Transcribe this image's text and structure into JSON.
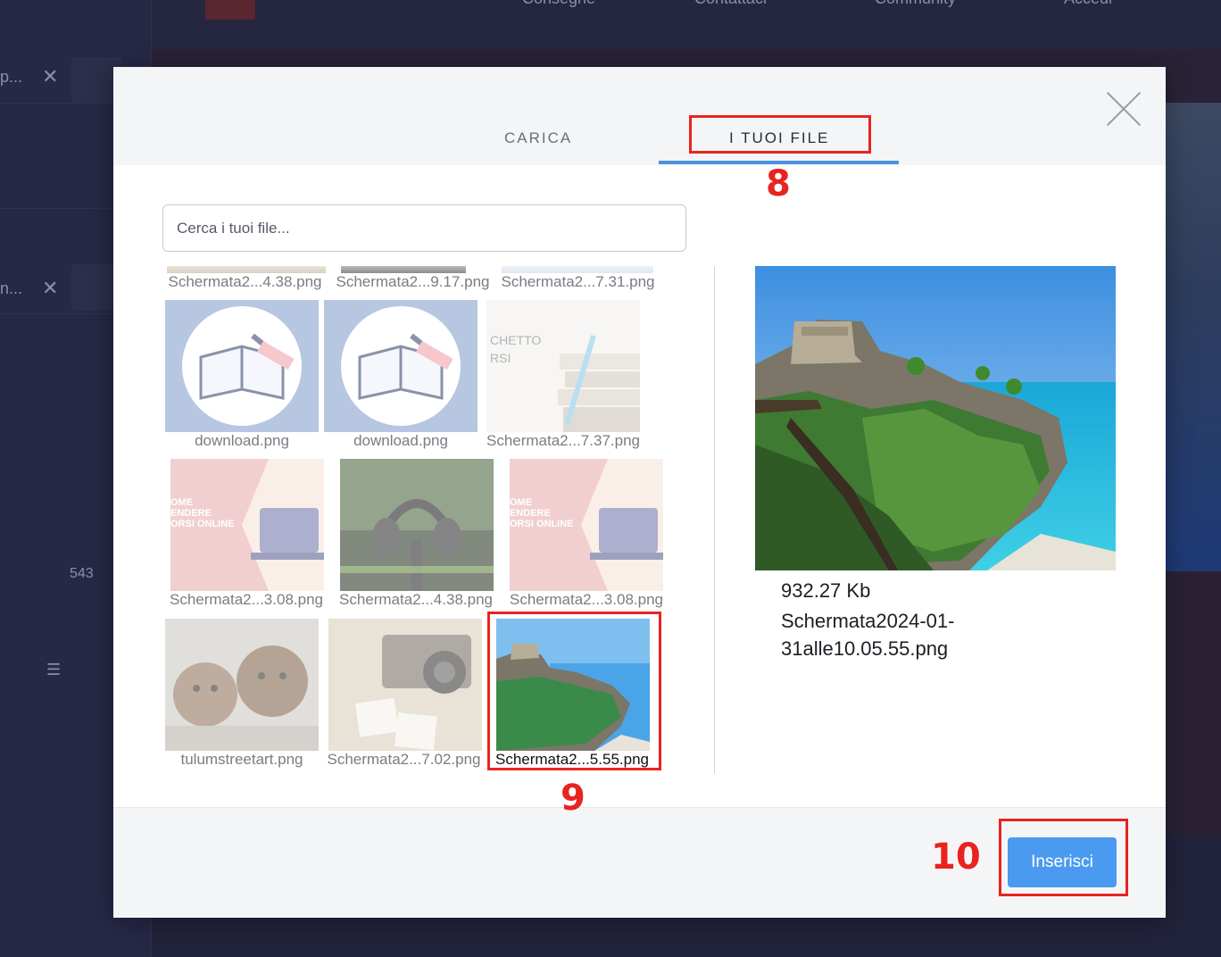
{
  "background": {
    "nav_items": [
      "Consegne",
      "Contattaci",
      "Community",
      "Accedi"
    ],
    "rows": [
      {
        "text": "p...",
        "close": "✕"
      },
      {
        "text": "n...",
        "close": "✕"
      }
    ],
    "count": "543"
  },
  "modal": {
    "tabs": [
      {
        "label": "CARICA",
        "active": false
      },
      {
        "label": "I TUOI FILE",
        "active": true
      }
    ],
    "search_placeholder": "Cerca i tuoi file...",
    "files": [
      {
        "label": "Schermata2...4.38.png",
        "partial": true,
        "colors": [
          "#e9e3d8",
          "#d8cfc3"
        ]
      },
      {
        "label": "Schermata2...9.17.png",
        "partial": true,
        "colors": [
          "#b9b9b9",
          "#8d8d8d"
        ]
      },
      {
        "label": "Schermata2...7.31.png",
        "partial": true,
        "colors": [
          "#eef3f7",
          "#dfe8ef"
        ]
      },
      {
        "label": "download.png",
        "icon": "book-writing-icon",
        "colors": [
          "#7d99c9",
          "#ffffff"
        ]
      },
      {
        "label": "download.png",
        "icon": "book-writing-icon",
        "colors": [
          "#7d99c9",
          "#ffffff"
        ]
      },
      {
        "label": "Schermata2...7.37.png",
        "icon": "books-stack-image",
        "colors": [
          "#f1efec",
          "#dcd5cb"
        ]
      },
      {
        "label": "Schermata2...3.08.png",
        "icon": "course-banner-image",
        "colors": [
          "#e6a9ad",
          "#f7e2d7"
        ]
      },
      {
        "label": "Schermata2...4.38.png",
        "icon": "headphones-image",
        "colors": [
          "#3f5a2f",
          "#1d2a18"
        ]
      },
      {
        "label": "Schermata2...3.08.png",
        "icon": "course-banner-image",
        "colors": [
          "#e6a9ad",
          "#f7e2d7"
        ]
      },
      {
        "label": "tulumstreetart.png",
        "icon": "street-art-image",
        "colors": [
          "#c9c6bf",
          "#7a6a58"
        ]
      },
      {
        "label": "Schermata2...7.02.png",
        "icon": "camera-photos-image",
        "colors": [
          "#d7cbb8",
          "#6f6558"
        ]
      },
      {
        "label": "Schermata2...5.55.png",
        "icon": "tulum-ruins-image",
        "selected": true,
        "colors": [
          "#4aa5e8",
          "#3a8a4a"
        ]
      }
    ],
    "preview": {
      "size": "932.27 Kb",
      "name": "Schermata2024-01-31alle10.05.55.png"
    },
    "insert_label": "Inserisci"
  },
  "annotations": [
    "8",
    "9",
    "10"
  ],
  "colors": {
    "accent": "#4a9bef",
    "annotation": "#e9231f"
  }
}
